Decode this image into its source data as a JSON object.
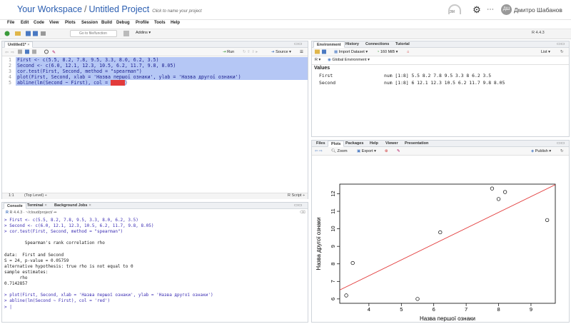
{
  "topbar": {
    "workspace": "Your Workspace",
    "separator": "/",
    "project": "Untitled Project",
    "project_hint": "Click to name your project",
    "ram": "3M",
    "user_initials": "ДШ",
    "user_name": "Дмитро Шабанов"
  },
  "menu": [
    "File",
    "Edit",
    "Code",
    "View",
    "Plots",
    "Session",
    "Build",
    "Debug",
    "Profile",
    "Tools",
    "Help"
  ],
  "toolbar": {
    "goto_placeholder": "Go to file/function",
    "addins": "Addins",
    "r_version": "R 4.4.3"
  },
  "editor": {
    "tab": "Untitled1*",
    "run": "Run",
    "source": "Source",
    "lines": [
      "First <- c(5.5, 8.2, 7.8, 9.5, 3.3, 8.0, 6.2, 3.5)",
      "Second <- c(6.0, 12.1, 12.3, 10.5, 6.2, 11.7, 9.8, 8.05)",
      "cor.test(First, Second, method = \"spearman\")",
      "plot(First, Second, xlab = 'Назва першої ознаки', ylab = 'Назва другої ознаки')",
      "abline(lm(Second ~ First), col = 'red')"
    ],
    "line5_prefix": "abline(lm(Second ~ First), col = ",
    "line5_red": "'red'",
    "line5_suffix": ")",
    "status_pos": "1:1",
    "status_level": "(Top Level)",
    "status_type": "R Script"
  },
  "console": {
    "tabs": [
      "Console",
      "Terminal",
      "Background Jobs"
    ],
    "path": "R 4.4.3 · ~/cloud/project/",
    "lines": [
      {
        "t": "cmd",
        "s": "> First <- c(5.5, 8.2, 7.8, 9.5, 3.3, 8.0, 6.2, 3.5)"
      },
      {
        "t": "cmd",
        "s": "> Second <- c(6.0, 12.1, 12.3, 10.5, 6.2, 11.7, 9.8, 8.05)"
      },
      {
        "t": "cmd",
        "s": "> cor.test(First, Second, method = \"spearman\")"
      },
      {
        "t": "out",
        "s": ""
      },
      {
        "t": "out",
        "s": "        Spearman's rank correlation rho"
      },
      {
        "t": "out",
        "s": ""
      },
      {
        "t": "out",
        "s": "data:  First and Second"
      },
      {
        "t": "out",
        "s": "S = 24, p-value = 0.05759"
      },
      {
        "t": "out",
        "s": "alternative hypothesis: true rho is not equal to 0"
      },
      {
        "t": "out",
        "s": "sample estimates:"
      },
      {
        "t": "out",
        "s": "      rho"
      },
      {
        "t": "out",
        "s": "0.7142857"
      },
      {
        "t": "out",
        "s": ""
      },
      {
        "t": "cmd",
        "s": "> plot(First, Second, xlab = 'Назва першої ознаки', ylab = 'Назва другої ознаки')"
      },
      {
        "t": "cmd",
        "s": "> abline(lm(Second ~ First), col = 'red')"
      },
      {
        "t": "cmd",
        "s": "> |"
      }
    ]
  },
  "environment": {
    "tabs": [
      "Environment",
      "History",
      "Connections",
      "Tutorial"
    ],
    "import": "Import Dataset",
    "mem": "160 MiB",
    "list": "List",
    "lang": "R",
    "scope": "Global Environment",
    "section": "Values",
    "vars": [
      {
        "name": "First",
        "value": "num [1:8] 5.5 8.2 7.8 9.5 3.3 8 6.2 3.5"
      },
      {
        "name": "Second",
        "value": "num [1:8] 6 12.1 12.3 10.5 6.2 11.7 9.8 8.05"
      }
    ]
  },
  "files_pane": {
    "tabs": [
      "Files",
      "Plots",
      "Packages",
      "Help",
      "Viewer",
      "Presentation"
    ],
    "zoom": "Zoom",
    "export": "Export",
    "publish": "Publish"
  },
  "chart_data": {
    "type": "scatter",
    "x": [
      5.5,
      8.2,
      7.8,
      9.5,
      3.3,
      8.0,
      6.2,
      3.5
    ],
    "y": [
      6.0,
      12.1,
      12.3,
      10.5,
      6.2,
      11.7,
      9.8,
      8.05
    ],
    "xlabel": "Назва першої ознаки",
    "ylabel": "Назва другої ознаки",
    "xlim": [
      3.1,
      9.75
    ],
    "ylim": [
      5.75,
      12.55
    ],
    "xticks": [
      4,
      5,
      6,
      7,
      8,
      9
    ],
    "yticks": [
      6,
      7,
      8,
      9,
      10,
      11,
      12
    ],
    "regression_line": {
      "color": "#e23b3b"
    },
    "point_color": "#000000"
  }
}
